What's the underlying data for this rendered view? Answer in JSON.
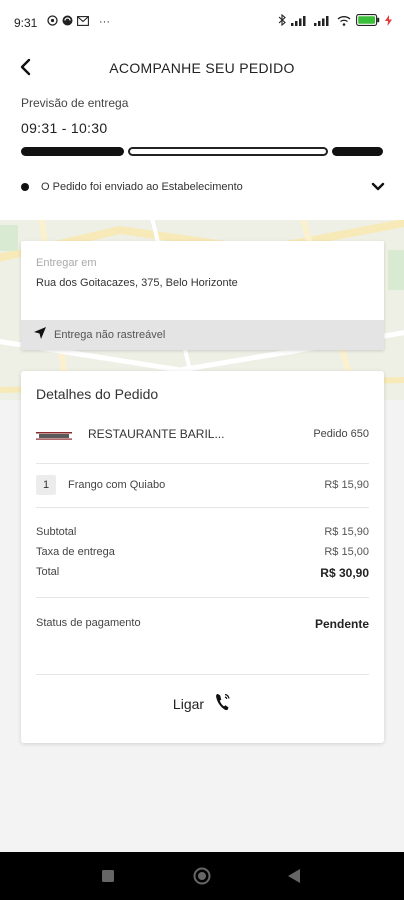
{
  "status_bar": {
    "time": "9:31",
    "more": "···"
  },
  "header": {
    "title": "ACOMPANHE SEU PEDIDO"
  },
  "estimate": {
    "label": "Previsão de entrega",
    "time_range": "09:31 - 10:30",
    "status_text": "O Pedido foi enviado ao Estabelecimento"
  },
  "address": {
    "label": "Entregar em",
    "value": "Rua dos Goitacazes, 375,  Belo Horizonte",
    "tracking_text": "Entrega não rastreável"
  },
  "order": {
    "title": "Detalhes do Pedido",
    "restaurant_name": "RESTAURANTE BARIL...",
    "order_number": "Pedido 650",
    "items": [
      {
        "qty": "1",
        "name": "Frango com Quiabo",
        "price": "R$ 15,90"
      }
    ],
    "subtotal_label": "Subtotal",
    "subtotal_value": "R$ 15,90",
    "delivery_label": "Taxa de entrega",
    "delivery_value": "R$ 15,00",
    "total_label": "Total",
    "total_value": "R$ 30,90",
    "payment_label": "Status de pagamento",
    "payment_value": "Pendente",
    "call_label": "Ligar"
  },
  "icons": {
    "back": "chevron-left-icon",
    "expand": "chevron-down-icon",
    "tracking": "navigation-arrow-icon",
    "call": "phone-ringing-icon"
  }
}
